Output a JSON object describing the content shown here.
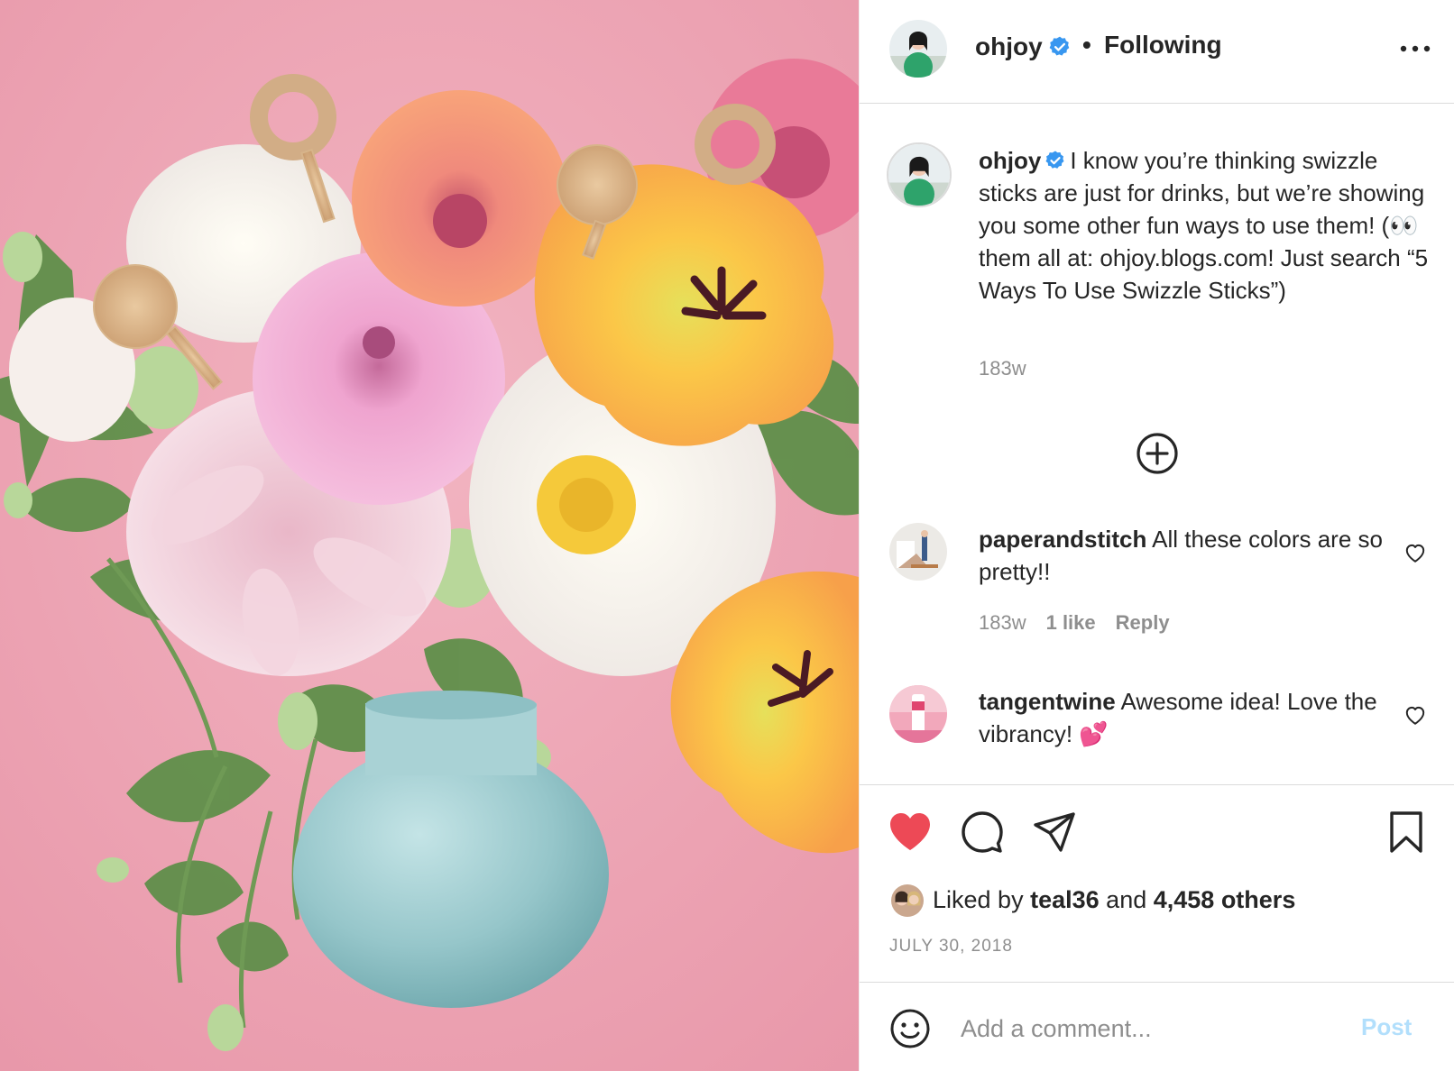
{
  "post": {
    "image_alt": "Bouquet of dahlias, peonies and parrot tulips with glitter swizzle sticks in a light blue vase on a pink background"
  },
  "header": {
    "username": "ohjoy",
    "separator": "•",
    "follow_status": "Following"
  },
  "caption": {
    "username": "ohjoy",
    "text": "I know you’re thinking swizzle sticks are just for drinks, but we’re showing you some other fun ways to use them! (👀 them all at: ohjoy.blogs.com! Just search “5 Ways To Use Swizzle Sticks”)",
    "time": "183w"
  },
  "comments": [
    {
      "username": "paperandstitch",
      "text": "All these colors are so pretty!!",
      "time": "183w",
      "likes": "1 like",
      "reply_label": "Reply"
    },
    {
      "username": "tangentwine",
      "text": "Awesome idea! Love the vibrancy! 💕"
    }
  ],
  "likes": {
    "prefix": "Liked by",
    "first_user": "teal36",
    "conjunction": "and",
    "others": "4,458 others"
  },
  "date": "JULY 30, 2018",
  "comment_box": {
    "placeholder": "Add a comment...",
    "post_label": "Post"
  },
  "colors": {
    "like_red": "#ed4956",
    "verified_blue": "#3897f0",
    "post_disabled": "#b2dffc",
    "muted_text": "#8e8e8e"
  },
  "icons": [
    "verified-badge-icon",
    "more-options-icon",
    "add-icon",
    "heart-outline-icon",
    "heart-filled-icon",
    "comment-icon",
    "share-icon",
    "bookmark-icon",
    "emoji-icon"
  ]
}
